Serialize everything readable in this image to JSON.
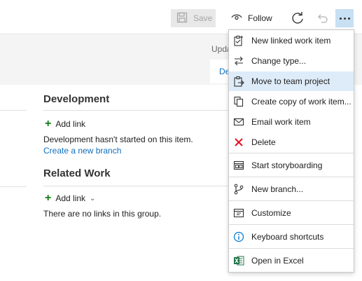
{
  "toolbar": {
    "save_label": "Save",
    "follow_label": "Follow"
  },
  "header": {
    "updated_partial": "Upda",
    "tab_partial": "De"
  },
  "development": {
    "title": "Development",
    "add_link_label": "Add link",
    "status_text": "Development hasn't started on this item.",
    "create_branch_link": "Create a new branch"
  },
  "related_work": {
    "title": "Related Work",
    "add_link_label": "Add link",
    "empty_text": "There are no links in this group."
  },
  "menu": {
    "items": [
      {
        "label": "New linked work item",
        "icon": "new-linked-work-item-icon"
      },
      {
        "label": "Change type...",
        "icon": "change-type-icon"
      },
      {
        "label": "Move to team project",
        "icon": "move-to-team-project-icon",
        "highlighted": true
      },
      {
        "label": "Create copy of work item...",
        "icon": "copy-icon"
      },
      {
        "label": "Email work item",
        "icon": "email-icon"
      },
      {
        "label": "Delete",
        "icon": "delete-icon",
        "color": "#e81123"
      },
      {
        "label": "Start storyboarding",
        "icon": "storyboard-icon"
      },
      {
        "label": "New branch...",
        "icon": "branch-icon"
      },
      {
        "label": "Customize",
        "icon": "customize-icon"
      },
      {
        "label": "Keyboard shortcuts",
        "icon": "info-icon",
        "color": "#0078d4"
      },
      {
        "label": "Open in Excel",
        "icon": "excel-icon",
        "color": "#217346"
      }
    ]
  },
  "colors": {
    "accent": "#106ebe",
    "menu_highlight": "#deecf9",
    "more_button_bg": "#c7e0f4",
    "add_green": "#107c10"
  }
}
